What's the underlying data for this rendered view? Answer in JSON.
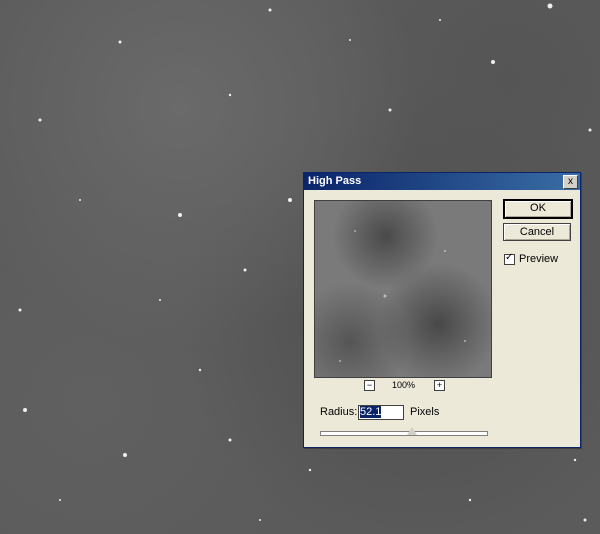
{
  "dialog": {
    "title": "High Pass",
    "close_label": "x",
    "ok_label": "OK",
    "cancel_label": "Cancel",
    "preview_label": "Preview",
    "preview_checked": true,
    "zoom": {
      "minus_label": "−",
      "plus_label": "+",
      "level": "100%"
    },
    "radius": {
      "label": "Radius:",
      "value": "52.1",
      "unit": "Pixels",
      "slider_fraction": 0.55
    }
  },
  "icons": {
    "close": "close-icon",
    "zoom_out": "zoom-out-icon",
    "zoom_in": "zoom-in-icon",
    "checkmark": "checkmark-icon"
  },
  "colors": {
    "titlebar_start": "#0a246a",
    "titlebar_end": "#3a6ea5",
    "dialog_bg": "#ece9d8",
    "selection": "#0a246a"
  }
}
